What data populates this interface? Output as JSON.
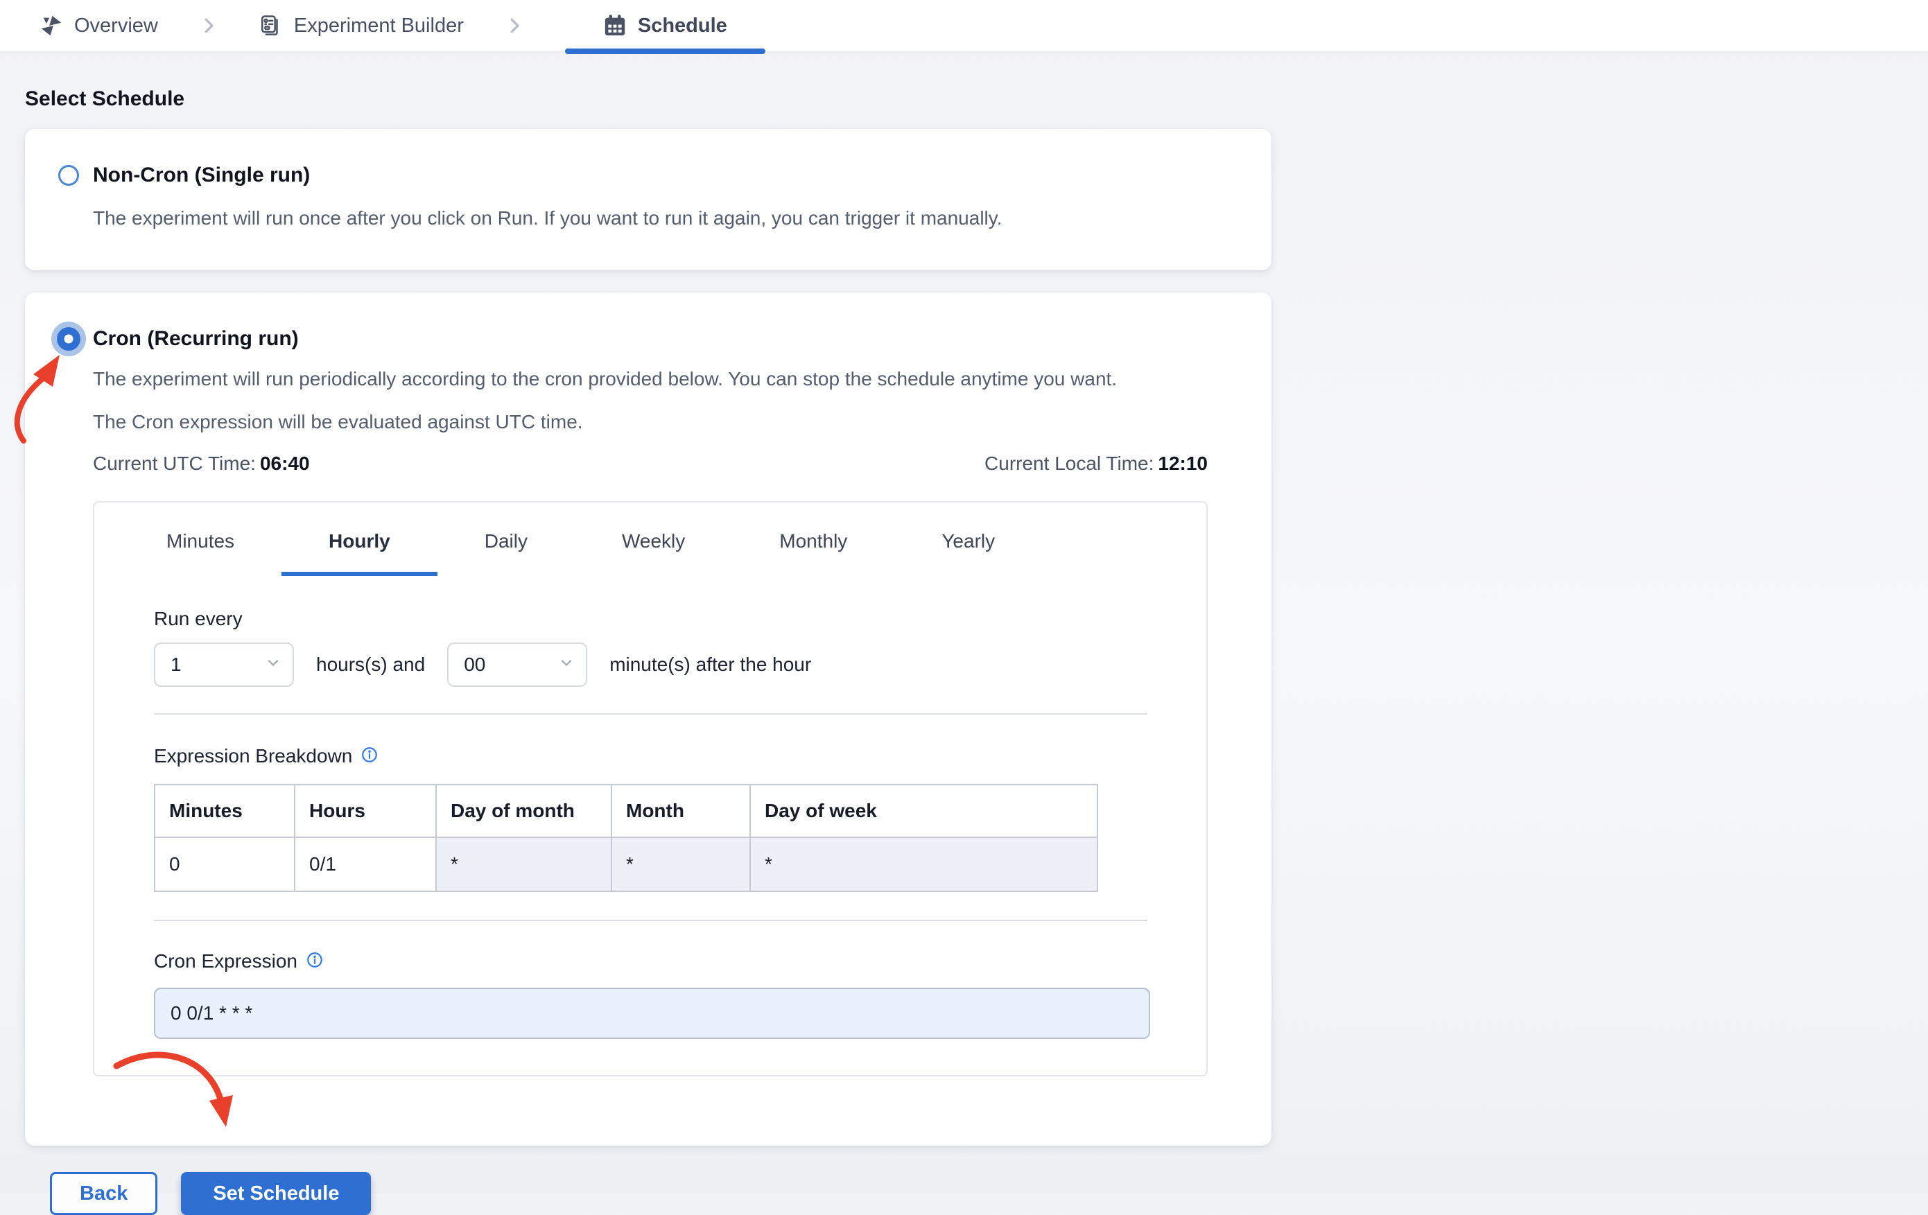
{
  "breadcrumb": {
    "items": [
      {
        "label": "Overview"
      },
      {
        "label": "Experiment Builder"
      },
      {
        "label": "Schedule"
      }
    ]
  },
  "page": {
    "title": "Select Schedule"
  },
  "options": {
    "non_cron": {
      "title": "Non-Cron (Single run)",
      "description": "The experiment will run once after you click on Run. If you want to run it again, you can trigger it manually."
    },
    "cron": {
      "title": "Cron (Recurring run)",
      "description_line1": "The experiment will run periodically according to the cron provided below. You can stop the schedule anytime you want.",
      "description_line2": "The Cron expression will be evaluated against UTC time.",
      "utc_label": "Current UTC Time:",
      "utc_value": "06:40",
      "local_label": "Current Local Time:",
      "local_value": "12:10"
    }
  },
  "scheduler": {
    "tabs": [
      "Minutes",
      "Hourly",
      "Daily",
      "Weekly",
      "Monthly",
      "Yearly"
    ],
    "active_tab": "Hourly",
    "hourly": {
      "run_every_label": "Run every",
      "hours_value": "1",
      "hours_suffix": "hours(s) and",
      "minutes_value": "00",
      "minutes_suffix": "minute(s) after the hour"
    },
    "breakdown": {
      "label": "Expression Breakdown",
      "headers": [
        "Minutes",
        "Hours",
        "Day of month",
        "Month",
        "Day of week"
      ],
      "row": [
        "0",
        "0/1",
        "*",
        "*",
        "*"
      ]
    },
    "cron_expression": {
      "label": "Cron Expression",
      "value": "0 0/1 * * *"
    }
  },
  "actions": {
    "back": "Back",
    "set_schedule": "Set Schedule"
  },
  "colors": {
    "accent": "#2e6fd1",
    "annotation_arrow": "#e8402a"
  }
}
